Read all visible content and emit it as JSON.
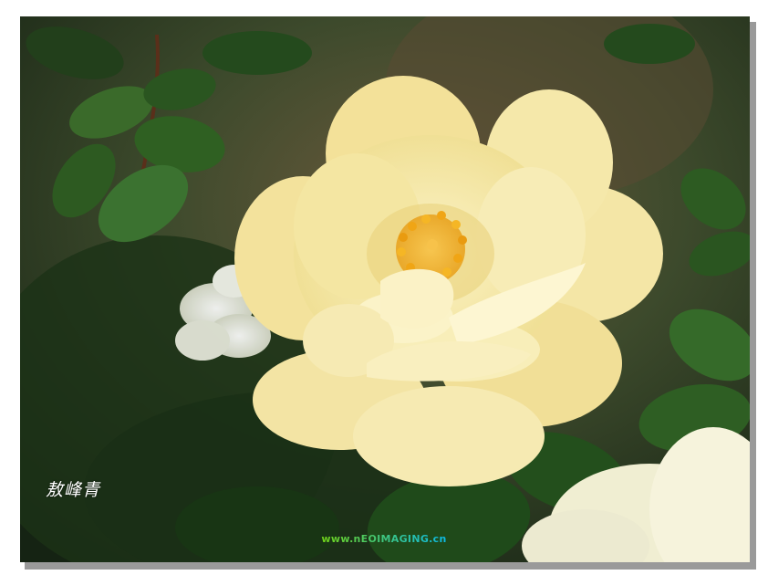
{
  "image": {
    "subject": "yellow-rose",
    "signature_text": "敖峰青",
    "watermark_text": "www.nEOIMAGING.cn",
    "colors": {
      "petal": "#f6eaa6",
      "petal_shadow": "#e6cf73",
      "stamen": "#f0a515",
      "leaf": "#2f5c22",
      "background": "#1d2e1a",
      "frame": "#ffffff"
    }
  }
}
